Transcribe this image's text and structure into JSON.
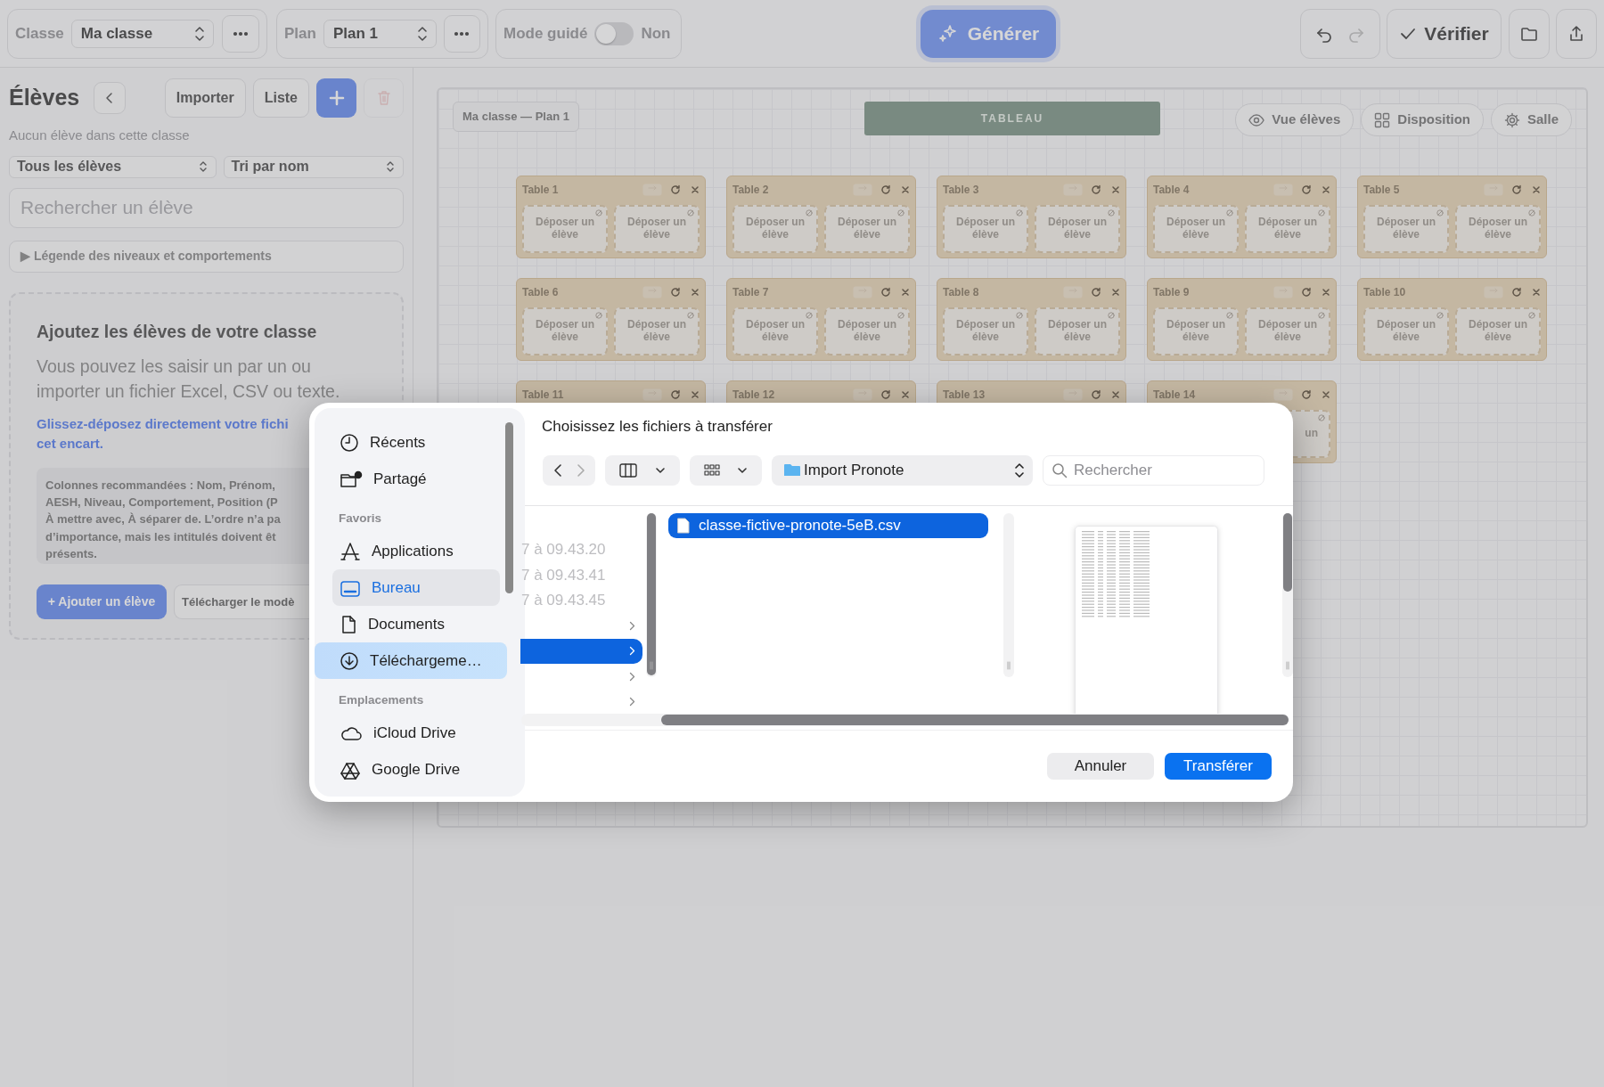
{
  "top_bar": {
    "class_label": "Classe",
    "class_select": "Ma classe",
    "plan_label": "Plan",
    "plan_select": "Plan 1",
    "guided_mode": {
      "label": "Mode guidé",
      "on": false,
      "state_text": "Non"
    },
    "generate_button": "Générer",
    "undo_disabled": false,
    "redo_disabled": true,
    "verify_button": "Vérifier"
  },
  "students_panel": {
    "title": "Élèves",
    "actions": [
      "Importer",
      "Liste"
    ],
    "delete_disabled": true,
    "status": "Aucun élève dans cette classe",
    "filter_select": "Tous les élèves",
    "sort_select": "Tri par nom",
    "search": {
      "placeholder": "Rechercher un élève"
    },
    "legend": "▶ Légende des niveaux et comportements",
    "empty_state": {
      "title": "Ajoutez les élèves de votre classe",
      "text": "Vous pouvez les saisir un par un ou importer un fichier Excel, CSV ou texte.",
      "drop_hint_lines": [
        "Glissez-déposez directement votre fichi",
        "cet encart."
      ],
      "columns_note_lines": [
        "Colonnes recommandées : Nom, Prénom,",
        "AESH, Niveau, Comportement, Position (P",
        "À mettre avec, À séparer de. L’ordre n’a pa",
        "d’importance, mais les intitulés doivent êt",
        "présents."
      ],
      "add_button": "+ Ajouter un élève",
      "template_button": "Télécharger le modè"
    }
  },
  "board": {
    "caption": "Ma classe — Plan 1",
    "front": "TABLEAU",
    "view_buttons": [
      "Vue élèves",
      "Disposition",
      "Salle"
    ],
    "tables": [
      {
        "name": "Table 1",
        "seats": [
          "Déposer un élève",
          "Déposer un élève"
        ]
      },
      {
        "name": "Table 2",
        "seats": [
          "Déposer un élève",
          "Déposer un élève"
        ]
      },
      {
        "name": "Table 3",
        "seats": [
          "Déposer un élève",
          "Déposer un élève"
        ]
      },
      {
        "name": "Table 4",
        "seats": [
          "Déposer un élève",
          "Déposer un élève"
        ]
      },
      {
        "name": "Table 5",
        "seats": [
          "Déposer un élève",
          "Déposer un élève"
        ]
      },
      {
        "name": "Table 6",
        "seats": [
          "Déposer un élève",
          "Déposer un élève"
        ]
      },
      {
        "name": "Table 7",
        "seats": [
          "Déposer un élève",
          "Déposer un élève"
        ]
      },
      {
        "name": "Table 8",
        "seats": [
          "Déposer un élève",
          "Déposer un élève"
        ]
      },
      {
        "name": "Table 9",
        "seats": [
          "Déposer un élève",
          "Déposer un élève"
        ]
      },
      {
        "name": "Table 10",
        "seats": [
          "Déposer un élève",
          "Déposer un élève"
        ]
      },
      {
        "name": "Table 11"
      },
      {
        "name": "Table 12"
      },
      {
        "name": "Table 13"
      },
      {
        "name": "Table 14",
        "partial_seat": "un"
      }
    ]
  },
  "file_dialog": {
    "title": "Choisissez les fichiers à transférer",
    "sidebar": [
      {
        "items": [
          {
            "label": "Récents",
            "selected": false,
            "highlighted": false
          },
          {
            "label": "Partagé",
            "selected": false,
            "highlighted": false
          }
        ]
      },
      {
        "heading": "Favoris",
        "items": [
          {
            "label": "Applications",
            "selected": false,
            "highlighted": false
          },
          {
            "label": "Bureau",
            "selected": true,
            "highlighted": false
          },
          {
            "label": "Documents",
            "selected": false,
            "highlighted": false
          },
          {
            "label": "Téléchargeme…",
            "selected": false,
            "highlighted": true
          }
        ]
      },
      {
        "heading": "Emplacements",
        "items": [
          {
            "label": "iCloud Drive",
            "selected": false,
            "highlighted": false
          },
          {
            "label": "Google Drive",
            "selected": false,
            "highlighted": false
          }
        ]
      }
    ],
    "location": "Import Pronote",
    "search": {
      "placeholder": "Rechercher"
    },
    "column_1": [
      {
        "text": "7 à 09.43.20",
        "folder": false,
        "disabled": true,
        "selected": false
      },
      {
        "text": "7 à 09.43.41",
        "folder": false,
        "disabled": true,
        "selected": false
      },
      {
        "text": "7 à 09.43.45",
        "folder": false,
        "disabled": true,
        "selected": false
      },
      {
        "folder": true,
        "disabled": false,
        "selected": false
      },
      {
        "folder": true,
        "disabled": false,
        "selected": true
      },
      {
        "folder": true,
        "disabled": false,
        "selected": false
      },
      {
        "folder": true,
        "disabled": false,
        "selected": false
      }
    ],
    "column_2": [
      {
        "text": "classe-fictive-pronote-5eB.csv",
        "selected": true
      }
    ],
    "buttons": [
      {
        "label": "Annuler",
        "primary": false
      },
      {
        "label": "Transférer",
        "primary": true
      }
    ]
  }
}
